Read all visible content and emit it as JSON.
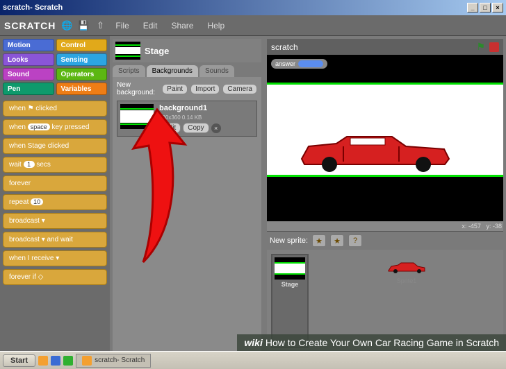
{
  "window": {
    "title": "scratch- Scratch",
    "min": "_",
    "max": "□",
    "close": "×"
  },
  "logo": "SCRATCH",
  "menu": [
    "File",
    "Edit",
    "Share",
    "Help"
  ],
  "categories": [
    {
      "label": "Motion",
      "cls": "cat-motion"
    },
    {
      "label": "Control",
      "cls": "cat-control"
    },
    {
      "label": "Looks",
      "cls": "cat-looks"
    },
    {
      "label": "Sensing",
      "cls": "cat-sensing"
    },
    {
      "label": "Sound",
      "cls": "cat-sound"
    },
    {
      "label": "Operators",
      "cls": "cat-operators"
    },
    {
      "label": "Pen",
      "cls": "cat-pen"
    },
    {
      "label": "Variables",
      "cls": "cat-variables"
    }
  ],
  "blocks": {
    "b0": "when ⚑ clicked",
    "b1_pre": "when",
    "b1_slot": "space",
    "b1_post": "key pressed",
    "b2": "when Stage clicked",
    "b3_pre": "wait",
    "b3_slot": "1",
    "b3_post": "secs",
    "b4": "forever",
    "b5_pre": "repeat",
    "b5_slot": "10",
    "b6": "broadcast ▾",
    "b7": "broadcast ▾ and wait",
    "b8": "when I receive ▾",
    "b9": "forever if ◇"
  },
  "stage_header": "Stage",
  "tabs": {
    "scripts": "Scripts",
    "backgrounds": "Backgrounds",
    "sounds": "Sounds"
  },
  "newbg": {
    "label": "New background:",
    "paint": "Paint",
    "import": "Import",
    "camera": "Camera"
  },
  "bgitem": {
    "name": "background1",
    "meta": "480x360   0.14 KB",
    "edit": "Edit",
    "copy": "Copy"
  },
  "project_name": "scratch",
  "answer_label": "answer",
  "coords": {
    "x_lbl": "x:",
    "x": "-457",
    "y_lbl": "y:",
    "y": "-38"
  },
  "new_sprite": "New sprite:",
  "sprite1": "Sprite1",
  "stage_label": "Stage",
  "taskbar": {
    "start": "Start",
    "task": "scratch- Scratch"
  },
  "wiki": {
    "logo": "wiki",
    "text": "How to Create Your Own Car Racing Game in Scratch"
  }
}
